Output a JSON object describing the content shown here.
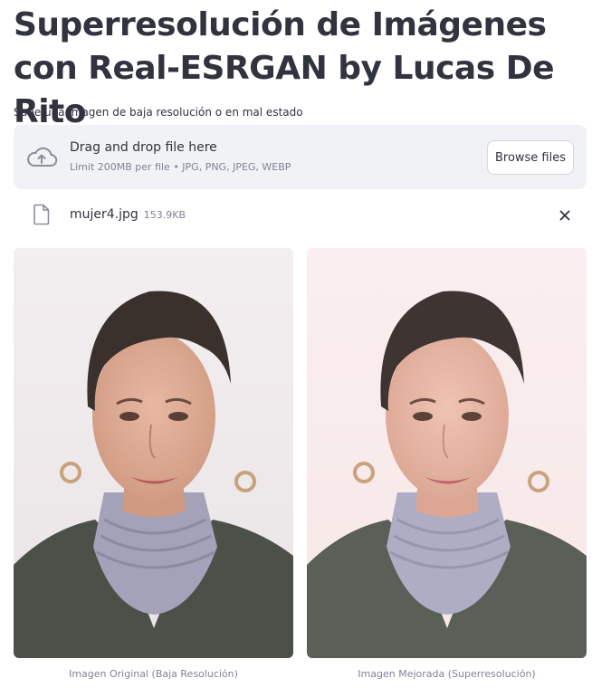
{
  "page": {
    "title": "Superresolución de Imágenes con Real-ESRGAN by Lucas De Rito"
  },
  "uploader": {
    "label": "Sube una imagen de baja resolución o en mal estado",
    "drop_text": "Drag and drop file here",
    "limit_text": "Limit 200MB per file • JPG, PNG, JPEG, WEBP",
    "browse_label": "Browse files",
    "icons": {
      "upload": "cloud-upload-icon",
      "file": "file-icon",
      "remove": "close-icon"
    }
  },
  "uploaded_file": {
    "name": "mujer4.jpg",
    "size": "153.9KB"
  },
  "images": [
    {
      "caption": "Imagen Original (Baja Resolución)"
    },
    {
      "caption": "Imagen Mejorada (Superresolución)"
    }
  ],
  "colors": {
    "text": "#31333f",
    "muted": "#808495",
    "dropzone_bg": "#f0f2f6",
    "border": "#d6d6d9"
  }
}
